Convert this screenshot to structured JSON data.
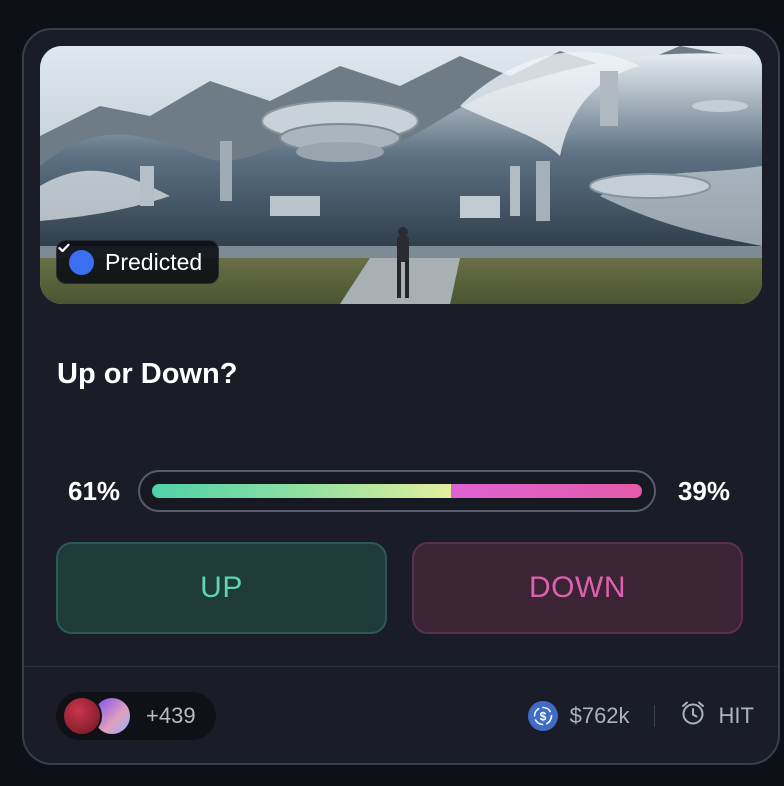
{
  "market": {
    "status_badge": "Predicted",
    "question": "Up or Down?",
    "up_percent_label": "61%",
    "down_percent_label": "39%",
    "up_share": 0.61,
    "up_button_label": "UP",
    "down_button_label": "DOWN"
  },
  "footer": {
    "participant_count": "+439",
    "volume": "$762k",
    "status": "HIT"
  },
  "icons": {
    "badge": "check-circle-icon",
    "volume": "usdc-coin-icon",
    "status": "alarm-clock-icon"
  },
  "colors": {
    "up": "#5fd3b2",
    "down": "#e060b0",
    "badge": "#3b6ff2"
  }
}
